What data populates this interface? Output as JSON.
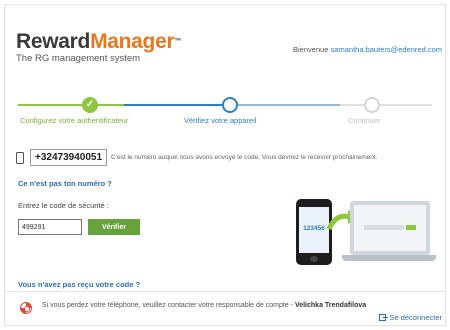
{
  "brand": {
    "name_part1": "Reward",
    "name_part2": "Manager",
    "tm": "™",
    "tagline": "The RG management system"
  },
  "header": {
    "welcome_prefix": "Bienvenue",
    "email": "samantha.bauters@edenred.com"
  },
  "steps": [
    {
      "label": "Configurez votre authentificateur",
      "status": "done"
    },
    {
      "label": "Vérifiez votre appareil",
      "status": "active"
    },
    {
      "label": "Continuer",
      "status": "pending"
    }
  ],
  "phone": {
    "number": "+32473940051",
    "note": "C'est le numéro auquel nous avons envoyé le code. Vous devriez le recevoir prochainement.",
    "not_your_number": "Ce n'est pas ton numéro ?"
  },
  "code": {
    "label": "Entrez le code de sécurité :",
    "value": "499291",
    "verify_label": "Vérifier",
    "not_received": "Vous n'avez pas reçu votre code ?"
  },
  "illustration": {
    "phone_code": "123456"
  },
  "footer": {
    "note": "Si vous perdez votre téléphone, veuillez contacter votre responsable de compte -",
    "contact_name": "Velichka Trendafilova",
    "logout": "Se déconnecter"
  },
  "colors": {
    "accent_green": "#8dc63f",
    "accent_blue": "#2d7fc1",
    "brand_orange": "#e87722"
  }
}
